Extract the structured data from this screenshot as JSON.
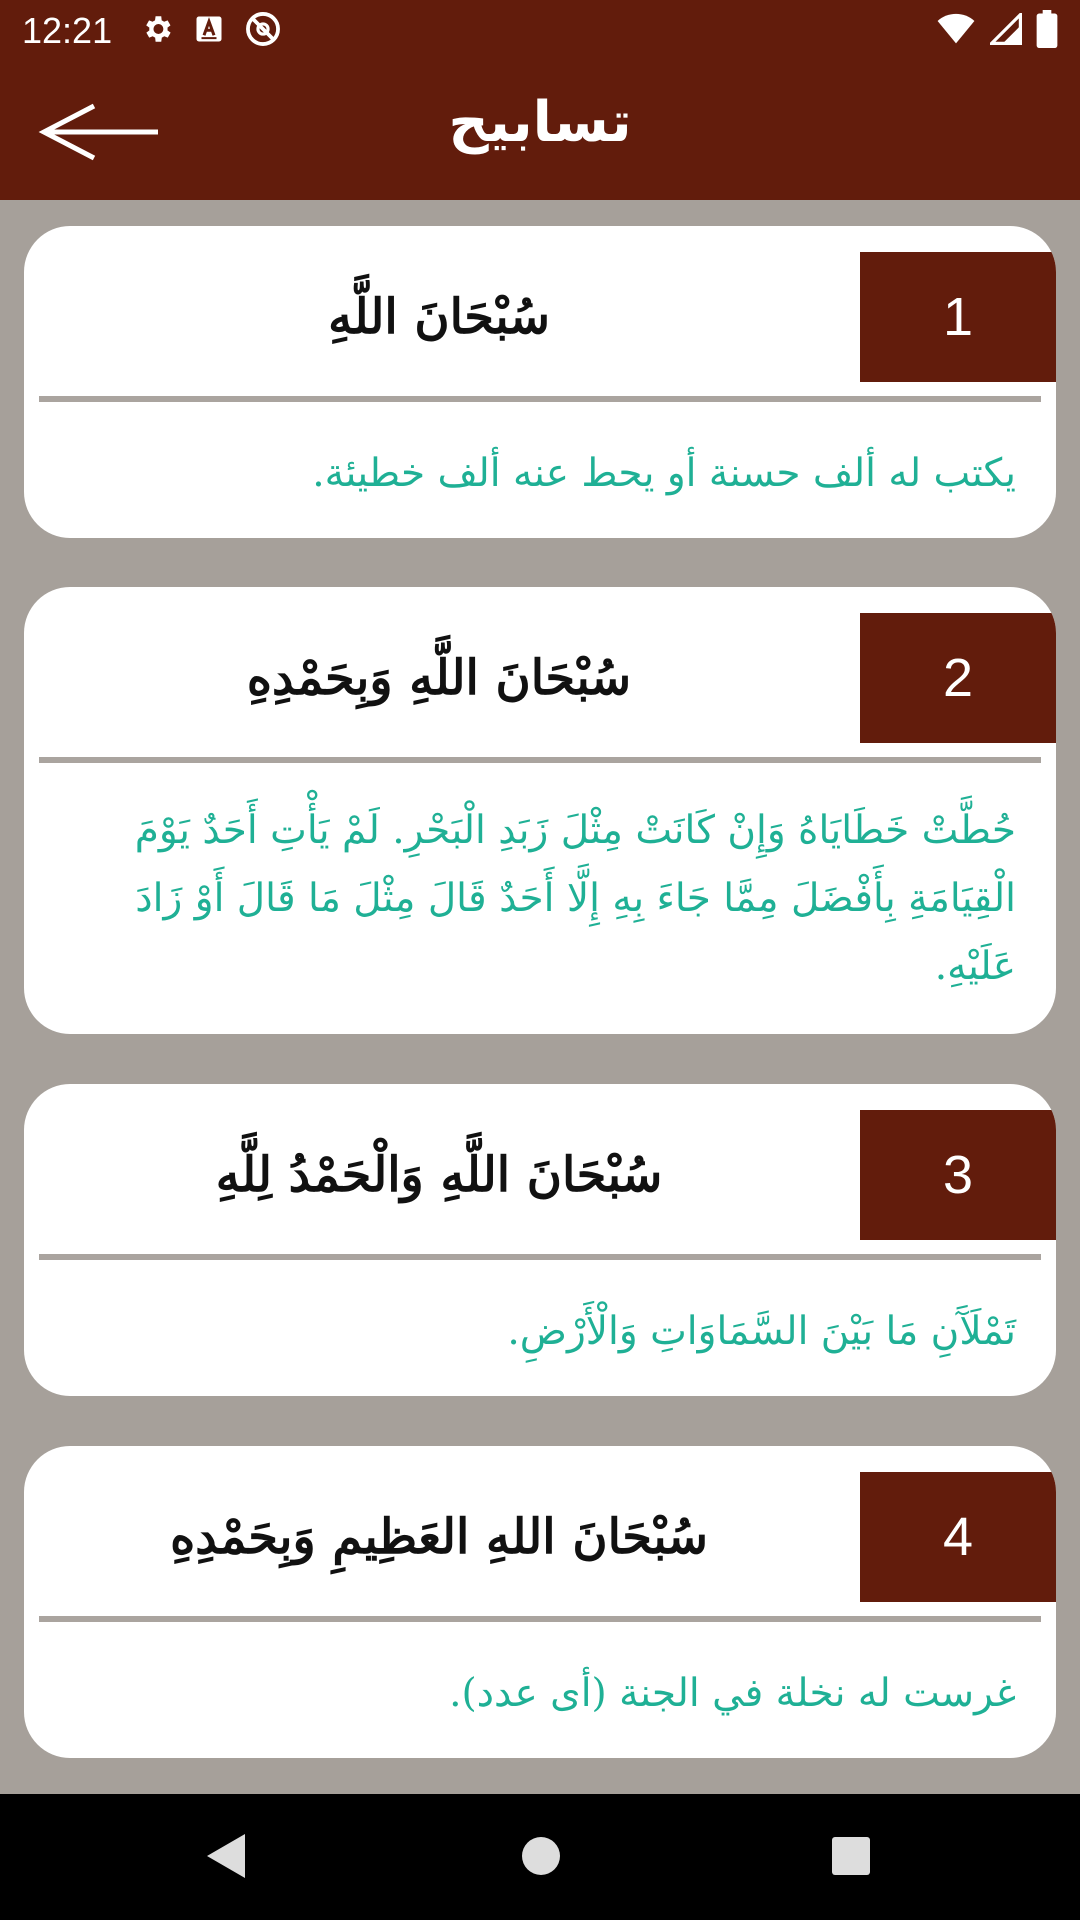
{
  "status_bar": {
    "time": "12:21",
    "icons_left": [
      "gear-icon",
      "a-badge-icon",
      "no-entry-icon"
    ],
    "icons_right": [
      "wifi-icon",
      "signal-icon",
      "battery-icon"
    ]
  },
  "app_bar": {
    "title": "تسابيح",
    "back_icon": "arrow-left-icon",
    "color": "#621c0c"
  },
  "colors": {
    "primary": "#621c0c",
    "background": "#a6a09a",
    "description": "#1fb095"
  },
  "cards": [
    {
      "number": "1",
      "title": "سُبْحَانَ اللَّهِ",
      "description": "يكتب له ألف حسنة أو يحط عنه ألف خطيئة."
    },
    {
      "number": "2",
      "title": "سُبْحَانَ اللَّهِ وَبِحَمْدِهِ",
      "description": "حُطَّتْ خَطَايَاهُ وَإِنْ كَانَتْ مِثْلَ زَبَدِ الْبَحْرِ. لَمْ يَأْتِ أَحَدٌ يَوْمَ الْقِيَامَةِ بِأَفْضَلَ مِمَّا جَاءَ بِهِ إِلَّا أَحَدٌ قَالَ مِثْلَ مَا قَالَ أَوْ زَادَ عَلَيْهِ."
    },
    {
      "number": "3",
      "title": "سُبْحَانَ اللَّهِ وَالْحَمْدُ لِلَّهِ",
      "description": "تَمْلَآَنِ مَا بَيْنَ السَّمَاوَاتِ وَالْأَرْضِ."
    },
    {
      "number": "4",
      "title": "سُبْحَانَ اللهِ العَظِيمِ وَبِحَمْدِهِ",
      "description": "غرست له نخلة في الجنة (أى عدد)."
    }
  ],
  "nav_bar": {
    "buttons": [
      "back-triangle-icon",
      "home-circle-icon",
      "recents-square-icon"
    ]
  }
}
